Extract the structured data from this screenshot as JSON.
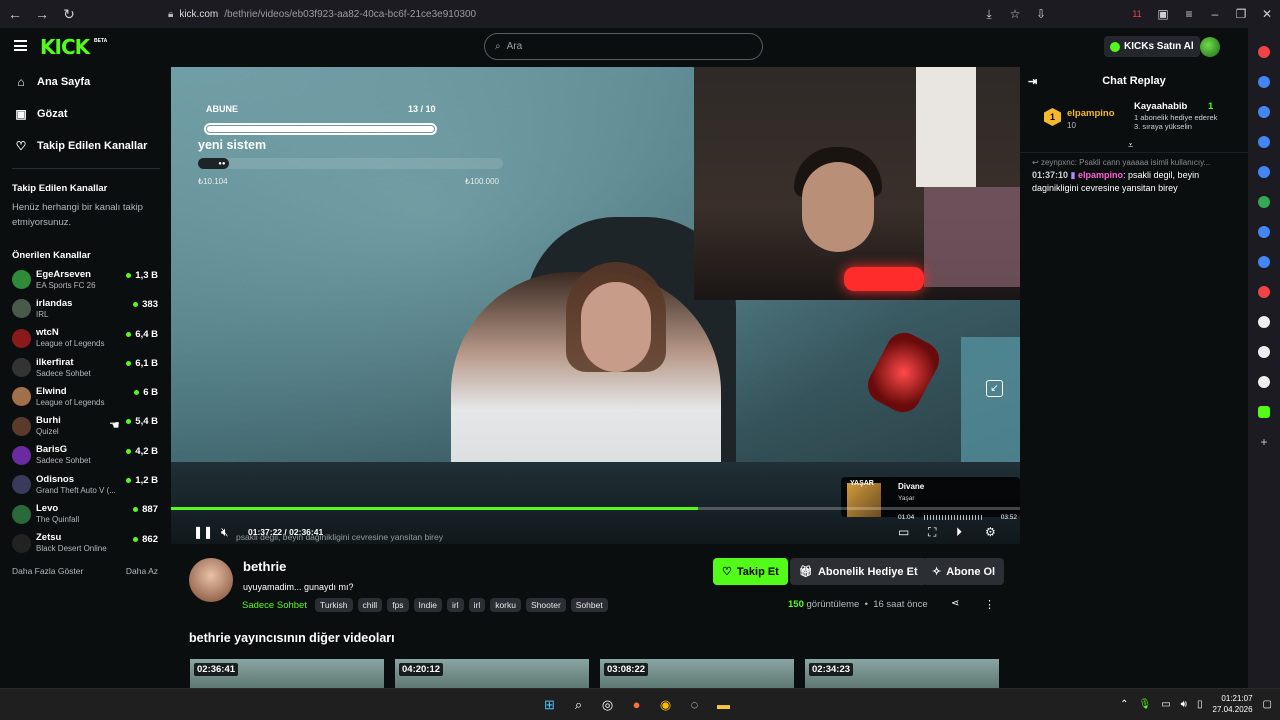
{
  "browser": {
    "url_host": "kick.com",
    "url_path": "/bethrie/videos/eb03f923-aa82-40ca-bc6f-21ce3e910300",
    "tab_badge": "11"
  },
  "header": {
    "logo": "KICK",
    "logo_badge": "BETA",
    "search_placeholder": "Ara",
    "buy_kicks": "KICKs Satın Al"
  },
  "sidebar": {
    "nav": [
      {
        "label": "Ana Sayfa",
        "icon": "home-icon"
      },
      {
        "label": "Gözat",
        "icon": "browse-icon"
      },
      {
        "label": "Takip Edilen Kanallar",
        "icon": "heart-icon"
      }
    ],
    "followed_title": "Takip Edilen Kanallar",
    "followed_empty": "Henüz herhangi bir kanalı takip etmiyorsunuz.",
    "recommended_title": "Önerilen Kanallar",
    "channels": [
      {
        "name": "EgeArseven",
        "category": "EA Sports FC 26",
        "viewers": "1,3 B",
        "color": "#2d8b3a"
      },
      {
        "name": "irlandas",
        "category": "IRL",
        "viewers": "383",
        "color": "#4a5a4a"
      },
      {
        "name": "wtcN",
        "category": "League of Legends",
        "viewers": "6,4 B",
        "color": "#8a1a1a"
      },
      {
        "name": "ilkerfirat",
        "category": "Sadece Sohbet",
        "viewers": "6,1 B",
        "color": "#333"
      },
      {
        "name": "Elwind",
        "category": "League of Legends",
        "viewers": "6 B",
        "color": "#a0704a"
      },
      {
        "name": "Burhi",
        "category": "Quizel",
        "viewers": "5,4 B",
        "color": "#5a3a2a"
      },
      {
        "name": "BarisG",
        "category": "Sadece Sohbet",
        "viewers": "4,2 B",
        "color": "#6a2aa0"
      },
      {
        "name": "Odisnos",
        "category": "Grand Theft Auto V (...",
        "viewers": "1,2 B",
        "color": "#3a3a5a"
      },
      {
        "name": "Levo",
        "category": "The Quinfall",
        "viewers": "887",
        "color": "#2a6a3a"
      },
      {
        "name": "Zetsu",
        "category": "Black Desert Online",
        "viewers": "862",
        "color": "#222"
      }
    ],
    "show_more": "Daha Fazla Göster",
    "show_less": "Daha Az"
  },
  "video": {
    "sub_goal_label": "ABUNE",
    "sub_goal_count": "13 / 10",
    "sub_goal_progress": 1.0,
    "donation_title": "yeni sistem",
    "donation_progress": 0.1,
    "donation_min": "₺10.104",
    "donation_max": "₺100.000",
    "time_current": "01:37:22",
    "time_sep": "/",
    "time_total": "02:36:41",
    "playback_progress": 0.621,
    "chat_overlay": "psakli degil, beyin daginikligini cevresine yansitan birey",
    "music_title": "Divane",
    "music_artist": "Yaşar",
    "music_time_a": "01:04",
    "music_time_b": "03:52",
    "music_art_label": "YAŞAR"
  },
  "meta": {
    "streamer": "bethrie",
    "title": "uyuyamadim... gunaydı mı?",
    "category": "Sadece Sohbet",
    "tags": [
      "Turkish",
      "chill",
      "fps",
      "Indie",
      "irl",
      "irl",
      "korku",
      "Shooter",
      "Sohbet"
    ],
    "follow_label": "Takip Et",
    "gift_label": "Abonelik Hediye Et",
    "subscribe_label": "Abone Ol",
    "views_count": "150",
    "views_label": "görüntüleme",
    "age": "16 saat önce",
    "other_videos_title": "bethrie yayıncısının diğer videoları",
    "other_videos": [
      "02:36:41",
      "04:20:12",
      "03:08:22",
      "02:34:23"
    ]
  },
  "chat": {
    "title": "Chat Replay",
    "pinned_rank": "1",
    "pinned_user": "elpampino",
    "pinned_count": "10",
    "pinned2_user": "Kayaahabib",
    "pinned2_count": "1",
    "pinned2_text": "1 abonelik hediye ederek 3. sıraya yükselin",
    "reply_context": "zeynpxnc: Psakli cann yaaaaa isimli kullanıcıy...",
    "message_time": "01:37:10",
    "message_author": "elpampino",
    "message_text": ": psakli degil, beyin daginikligini cevresine yansitan birey"
  },
  "taskbar": {
    "time": "01:21:07",
    "date": "27.04.2026"
  }
}
